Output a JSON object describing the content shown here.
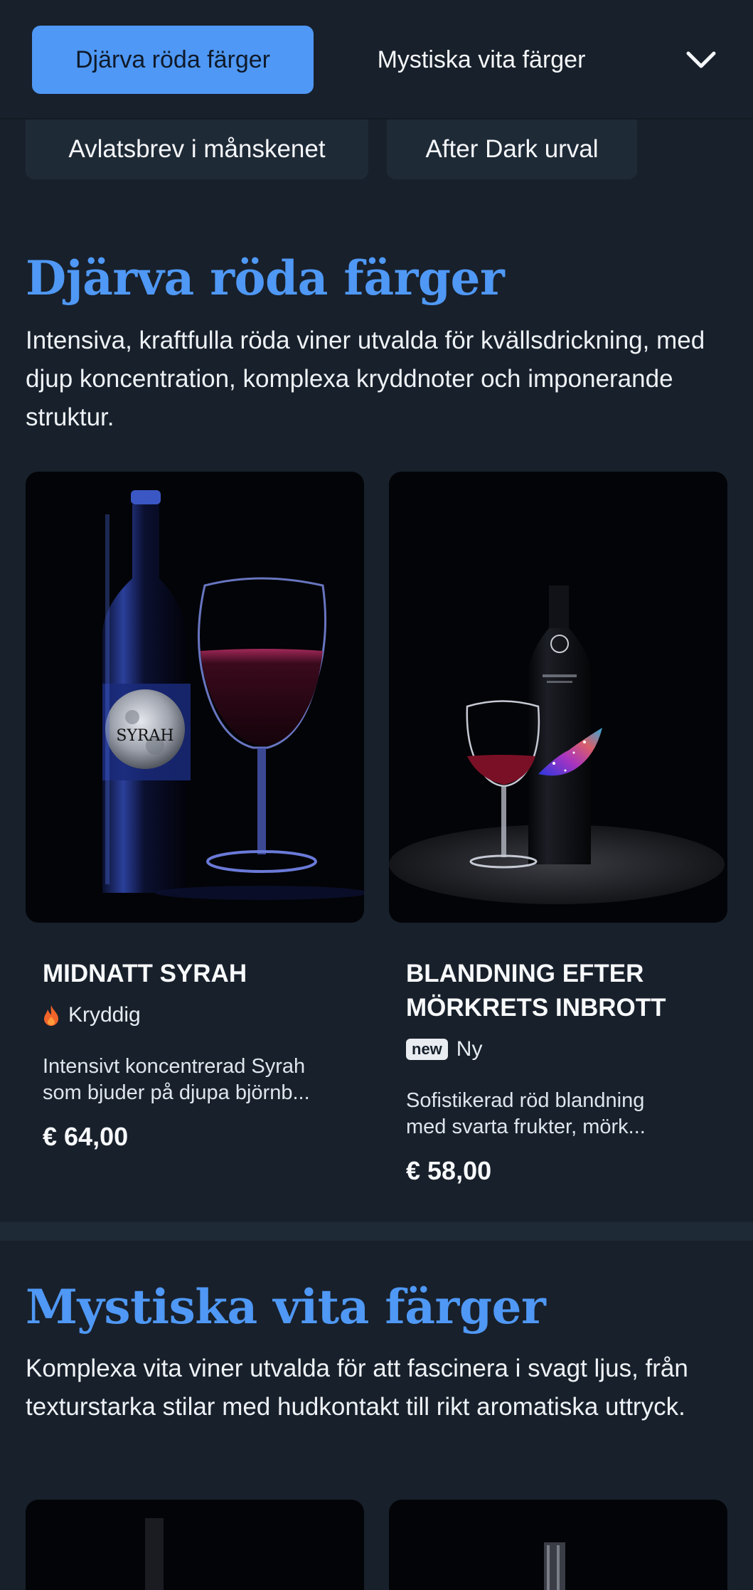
{
  "nav": {
    "tabs": [
      {
        "label": "Djärva röda färger",
        "active": true
      },
      {
        "label": "Mystiska vita färger",
        "active": false
      }
    ],
    "chips": [
      {
        "label": "Avlatsbrev i månskenet"
      },
      {
        "label": "After Dark urval"
      }
    ],
    "dropdown_icon": "chevron-down-icon"
  },
  "sections": [
    {
      "title": "Djärva röda färger",
      "description": "Intensiva, kraftfulla röda viner utvalda för kvällsdrickning, med djup koncentration, komplexa kryddnoter och imponerande struktur.",
      "products": [
        {
          "name": "MIDNATT SYRAH",
          "tag_icon": "flame-icon",
          "tag": "Kryddig",
          "description_line1": "Intensivt koncentrerad Syrah",
          "description_line2": "som bjuder på djupa björnb...",
          "price": "€ 64,00",
          "label_text": "SYRAH"
        },
        {
          "name_line1": "BLANDNING EFTER",
          "name_line2": "MÖRKRETS INBROTT",
          "tag_badge": "new",
          "tag": "Ny",
          "description_line1": "Sofistikerad röd blandning",
          "description_line2": "med svarta frukter, mörk...",
          "price": "€ 58,00"
        }
      ]
    },
    {
      "title": "Mystiska vita färger",
      "description": "Komplexa vita viner utvalda för att fascinera i svagt ljus, från texturstarka stilar med hudkontakt till rikt aromatiska uttryck."
    }
  ],
  "colors": {
    "background": "#18202b",
    "accent": "#4f98f5",
    "chip": "#1f2a37",
    "flame": "#f0642a"
  }
}
